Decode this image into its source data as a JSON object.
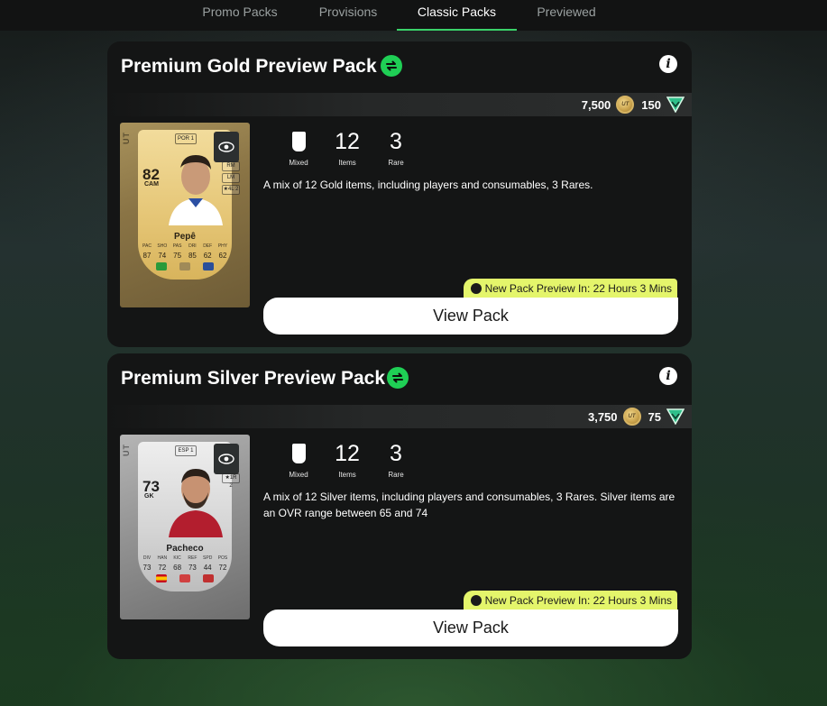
{
  "tabs": [
    "Promo Packs",
    "Provisions",
    "Classic Packs",
    "Previewed"
  ],
  "colors": {
    "accent_green": "#1fcf55",
    "timer_yellow": "#e4f56b",
    "tab_underline": "#3ad26a"
  },
  "packs": [
    {
      "title": "Premium Gold Preview Pack",
      "coins": "7,500",
      "coin_icon_label": "UT",
      "points": "150",
      "stats": {
        "mixed_label": "Mixed",
        "items_value": "12",
        "items_label": "Items",
        "rare_value": "3",
        "rare_label": "Rare"
      },
      "description": "A mix of 12 Gold items, including players and consumables, 3 Rares.",
      "timer": "New Pack Preview In: 22 Hours 3 Mins",
      "button": "View Pack",
      "card": {
        "tier": "gold",
        "side_text": "UT",
        "rating": "82",
        "position": "CAM",
        "league": "POR 1",
        "roles": [
          "RM",
          "LM",
          "★4L 2"
        ],
        "name": "Pepê",
        "stat_labels": [
          "PAC",
          "SHO",
          "PAS",
          "DRI",
          "DEF",
          "PHY"
        ],
        "stat_values": [
          "87",
          "74",
          "75",
          "85",
          "62",
          "62"
        ]
      }
    },
    {
      "title": "Premium Silver Preview Pack",
      "coins": "3,750",
      "coin_icon_label": "UT",
      "points": "75",
      "stats": {
        "mixed_label": "Mixed",
        "items_value": "12",
        "items_label": "Items",
        "rare_value": "3",
        "rare_label": "Rare"
      },
      "description": "A mix of 12 Silver items, including players and consumables, 3 Rares. Silver items are an OVR range between 65 and 74",
      "timer": "New Pack Preview In: 22 Hours 3 Mins",
      "button": "View Pack",
      "card": {
        "tier": "silver",
        "side_text": "UT",
        "rating": "73",
        "position": "GK",
        "league": "ESP 1",
        "roles": [
          "★1R 2"
        ],
        "name": "Pacheco",
        "stat_labels": [
          "DIV",
          "HAN",
          "KIC",
          "REF",
          "SPD",
          "POS"
        ],
        "stat_values": [
          "73",
          "72",
          "68",
          "73",
          "44",
          "72"
        ]
      }
    }
  ]
}
